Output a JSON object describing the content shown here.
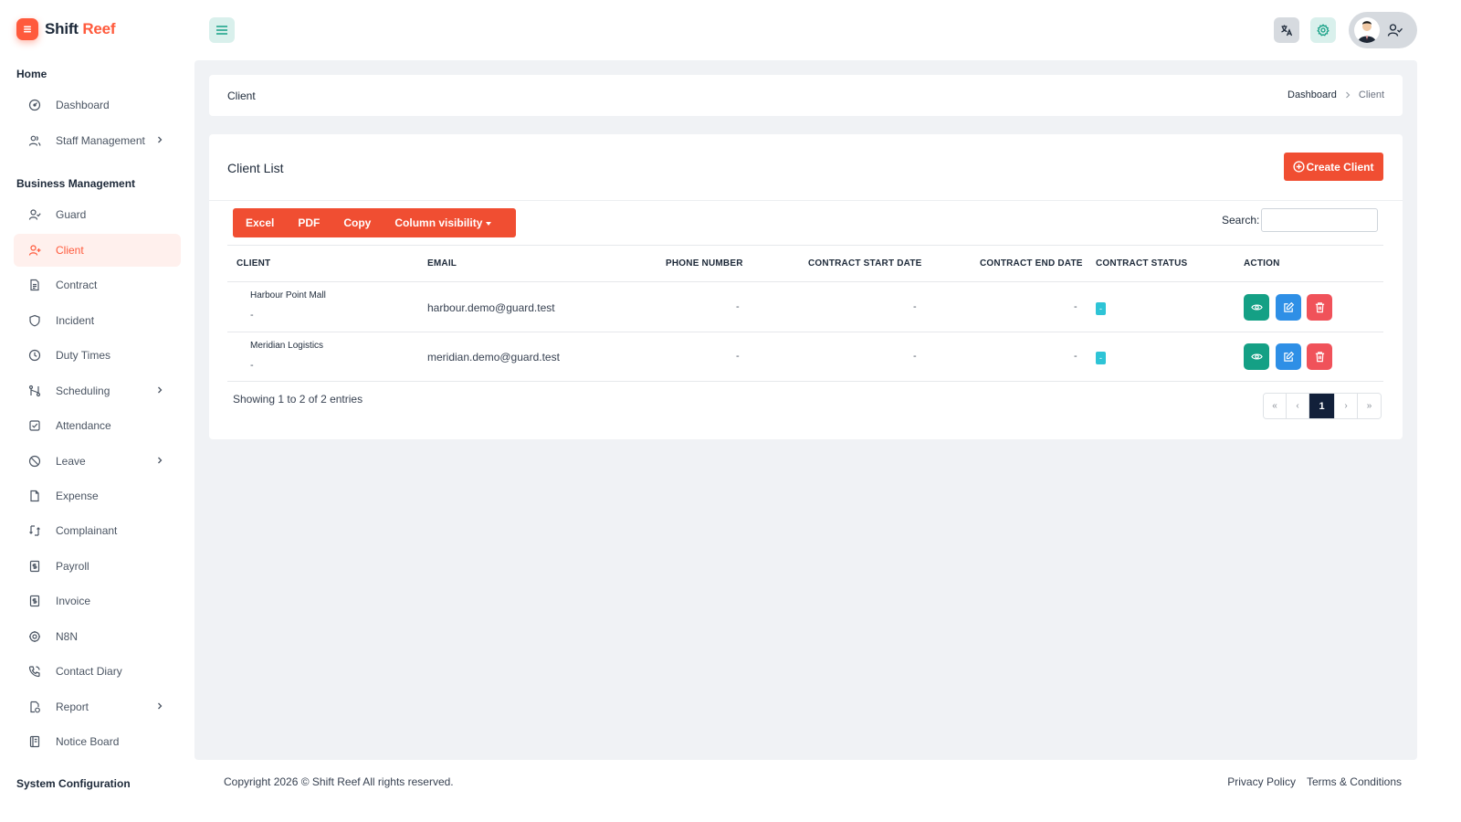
{
  "brand": {
    "name_part1": "Shift",
    "name_part2": "Reef",
    "accent": "#ff5a3c"
  },
  "sidebar": {
    "sections": [
      {
        "title": "Home"
      },
      {
        "title": "Business Management"
      },
      {
        "title": "System Configuration"
      }
    ],
    "items": [
      {
        "label": "Dashboard",
        "icon": "dashboard-icon"
      },
      {
        "label": "Staff Management",
        "icon": "users-icon",
        "has_submenu": true
      },
      {
        "label": "Guard",
        "icon": "user-check-icon"
      },
      {
        "label": "Client",
        "icon": "user-plus-icon",
        "active": true
      },
      {
        "label": "Contract",
        "icon": "document-icon"
      },
      {
        "label": "Incident",
        "icon": "shield-icon"
      },
      {
        "label": "Duty Times",
        "icon": "clock-icon"
      },
      {
        "label": "Scheduling",
        "icon": "route-icon",
        "has_submenu": true
      },
      {
        "label": "Attendance",
        "icon": "checkbox-icon"
      },
      {
        "label": "Leave",
        "icon": "leave-icon",
        "has_submenu": true
      },
      {
        "label": "Expense",
        "icon": "file-icon"
      },
      {
        "label": "Complainant",
        "icon": "swap-icon"
      },
      {
        "label": "Payroll",
        "icon": "receipt-icon"
      },
      {
        "label": "Invoice",
        "icon": "invoice-icon"
      },
      {
        "label": "N8N",
        "icon": "cog-icon"
      },
      {
        "label": "Contact Diary",
        "icon": "phone-icon"
      },
      {
        "label": "Report",
        "icon": "report-icon",
        "has_submenu": true
      },
      {
        "label": "Notice Board",
        "icon": "notice-icon"
      }
    ]
  },
  "breadcrumb": {
    "title": "Client",
    "trail": [
      "Dashboard",
      "Client"
    ]
  },
  "list": {
    "title": "Client List",
    "create_label": "Create Client",
    "export_buttons": [
      "Excel",
      "PDF",
      "Copy",
      "Column visibility"
    ],
    "search_label": "Search:",
    "search_value": "",
    "columns": [
      "CLIENT",
      "EMAIL",
      "PHONE NUMBER",
      "CONTRACT START DATE",
      "CONTRACT END DATE",
      "CONTRACT STATUS",
      "ACTION"
    ],
    "rows": [
      {
        "client": "Harbour Point Mall",
        "client_sub": "-",
        "email": "harbour.demo@guard.test",
        "phone": "-",
        "start": "-",
        "end": "-",
        "status": "-"
      },
      {
        "client": "Meridian Logistics",
        "client_sub": "-",
        "email": "meridian.demo@guard.test",
        "phone": "-",
        "start": "-",
        "end": "-",
        "status": "-"
      }
    ],
    "showing": "Showing 1 to 2 of 2 entries",
    "pager": [
      "«",
      "‹",
      "1",
      "›",
      "»"
    ],
    "current_page": "1"
  },
  "footer": {
    "copyright": "Copyright 2026 © Shift Reef All rights reserved.",
    "links": [
      "Privacy Policy",
      "Terms & Conditions"
    ]
  },
  "colors": {
    "primary": "#f04e32",
    "view": "#14a085",
    "edit": "#2e8fe6",
    "delete": "#f0525a",
    "status": "#2ec4d6",
    "page_active": "#12203a"
  }
}
